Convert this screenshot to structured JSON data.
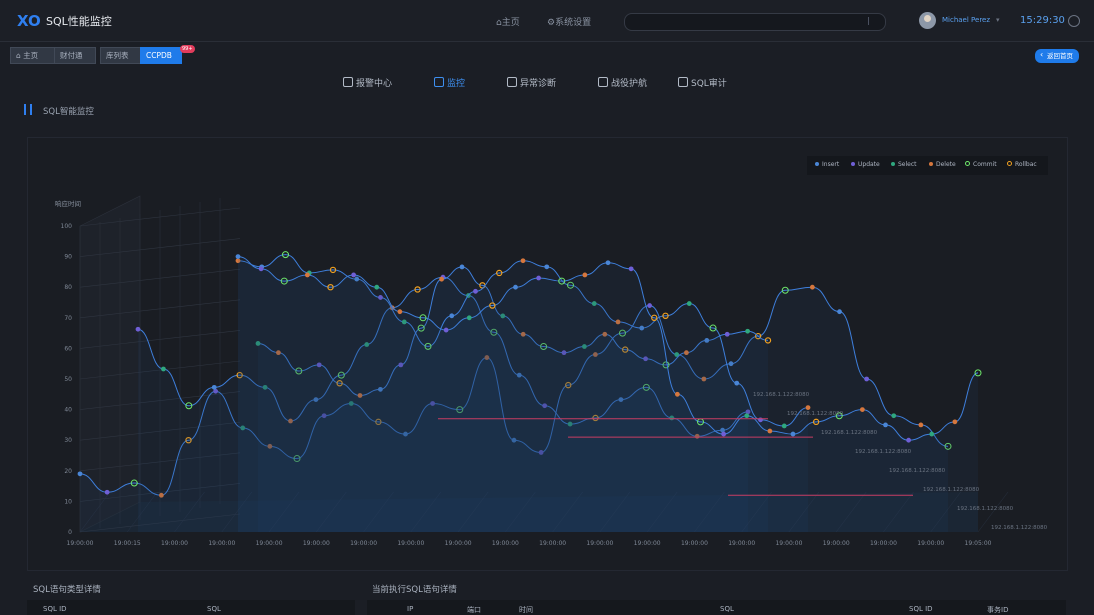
{
  "header": {
    "logo_text": "XO",
    "app_title": "SQL性能监控",
    "nav": [
      {
        "icon": "home-icon",
        "label": "主页"
      },
      {
        "icon": "settings-icon",
        "label": "系统设置"
      }
    ],
    "search_placeholder": "",
    "user_name": "Michael Perez",
    "clock": "15:29:30"
  },
  "breadcrumb": {
    "items": [
      "主页",
      "财付通",
      "库列表",
      "CCPDB"
    ],
    "badge": "99+",
    "back_label": "返回首页"
  },
  "tabs": [
    {
      "label": "报警中心",
      "icon": "alarm-icon",
      "active": false
    },
    {
      "label": "监控",
      "icon": "warning-icon",
      "active": true
    },
    {
      "label": "异常诊断",
      "icon": "diagnose-icon",
      "active": false
    },
    {
      "label": "战役护航",
      "icon": "shield-icon",
      "active": false
    },
    {
      "label": "SQL审计",
      "icon": "audit-icon",
      "active": false
    }
  ],
  "panel": {
    "title": "SQL智能监控"
  },
  "colors": {
    "accent": "#1f7bea",
    "line": "#3e7fdc",
    "insert": "#4a86d6",
    "update": "#6f5fd6",
    "select": "#2fa77e",
    "delete": "#d6773d",
    "commit": "#6fe86b",
    "rollback": "#f0a020",
    "hline": "#c83c63"
  },
  "chart_data": {
    "type": "line",
    "ylabel": "响应时间",
    "y_ticks": [
      0,
      10,
      20,
      30,
      40,
      50,
      60,
      70,
      80,
      90,
      100
    ],
    "x_ticks": [
      "19:00:00",
      "19:00:15",
      "19:00:00",
      "19:00:00",
      "19:00:00",
      "19:00:00",
      "19:00:00",
      "19:00:00",
      "19:00:00",
      "19:00:00",
      "19:00:00",
      "19:00:00",
      "19:00:00",
      "19:00:00",
      "19:00:00",
      "19:00:00",
      "19:00:00",
      "19:00:00",
      "19:00:00",
      "19:05:00"
    ],
    "z_labels": [
      "192.168.1.122:8080",
      "192.168.1.122:8080",
      "192.168.1.122:8080",
      "192.168.1.122:8080",
      "192.168.1.122:8080",
      "192.168.1.122:8080",
      "192.168.1.122:8080",
      "192.168.1.122:8080"
    ],
    "legend": [
      "Insert",
      "Update",
      "Select",
      "Delete",
      "Commit",
      "Rollbac"
    ],
    "series": [
      {
        "y": [
          19,
          13,
          16,
          12,
          30,
          46,
          34,
          28,
          24,
          38,
          42,
          36,
          32,
          42,
          40,
          57,
          30,
          26,
          48,
          58,
          65,
          74,
          58,
          50,
          55,
          64,
          79,
          80,
          72,
          50,
          38,
          35,
          28
        ]
      },
      {
        "y": [
          63,
          50,
          38,
          44,
          48,
          44,
          33,
          40,
          48,
          58,
          70,
          76,
          80,
          74,
          62,
          48,
          38,
          32,
          34,
          40,
          44,
          34,
          28,
          30,
          36
        ]
      },
      {
        "y": [
          59,
          56,
          50,
          52,
          46,
          42,
          44,
          52,
          64,
          80,
          84,
          78,
          68,
          62,
          58,
          56,
          58,
          62,
          57,
          54,
          52,
          56,
          60,
          62,
          63,
          60
        ]
      },
      {
        "y": [
          88,
          86,
          90,
          84,
          85,
          82,
          76,
          68,
          60,
          70,
          78,
          84,
          88,
          86,
          80,
          74,
          68,
          66,
          70,
          74,
          66,
          48,
          36,
          34,
          40
        ]
      },
      {
        "y": [
          90,
          86,
          82,
          84,
          80,
          84,
          80,
          72,
          70,
          66,
          70,
          74,
          80,
          83,
          82,
          84,
          88,
          86,
          70,
          45,
          36,
          32,
          38,
          33,
          32,
          36,
          38,
          40,
          35,
          30,
          32,
          36,
          52
        ]
      }
    ]
  }
}
